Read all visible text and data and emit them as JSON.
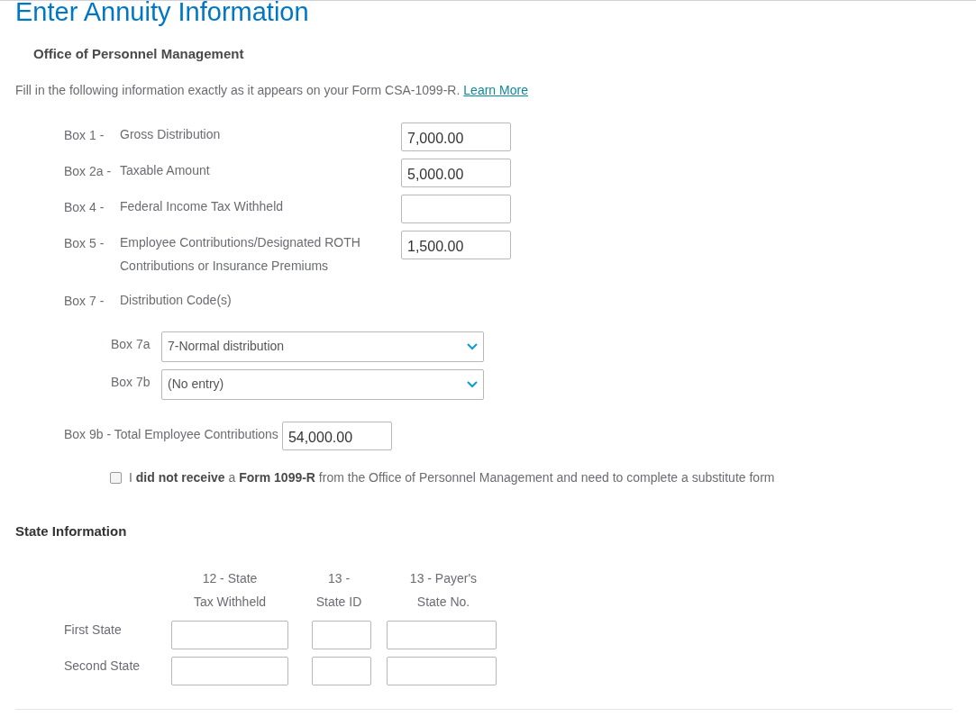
{
  "page": {
    "title": "Enter Annuity Information"
  },
  "section": {
    "heading": "Office of Personnel Management",
    "intro": "Fill in the following information exactly as it appears on your Form CSA-1099-R.",
    "link": "Learn More"
  },
  "boxes": [
    {
      "kind": "input",
      "box": "Box 1 -",
      "label": "Gross Distribution",
      "value": "7,000.00"
    },
    {
      "kind": "input",
      "box": "Box 2a -",
      "label": "Taxable Amount",
      "value": "5,000.00"
    },
    {
      "kind": "input",
      "box": "Box 4 -",
      "label": "Federal Income Tax Withheld"
    },
    {
      "kind": "input",
      "box": "Box 5 -",
      "label": "Employee Contributions/Designated ROTH Contributions or Insurance Premiums",
      "value": "1,500.00"
    },
    {
      "kind": "heading",
      "box": "Box 7 -",
      "label": "Distribution Code(s)"
    }
  ],
  "distribution_codes": [
    {
      "label": "Box 7a",
      "value": "7-Normal distribution"
    },
    {
      "label": "Box 7b",
      "value": "(No entry)"
    }
  ],
  "box_9b": {
    "label": "Box 9b - Total Employee Contributions",
    "value": "54,000.00"
  },
  "substitute_form": {
    "checked": false,
    "text": "I **did not receive** a **Form 1099-R** from the Office of Personnel Management and need to complete a substitute form"
  },
  "state_information": {
    "heading": "State Information",
    "columns": [
      {
        "line1": "12 - State",
        "line2": "Tax Withheld"
      },
      {
        "line1": "13 -",
        "line2": "State ID"
      },
      {
        "line1": "13 - Payer's",
        "line2": "State No."
      }
    ],
    "rows": [
      {
        "label": "First State"
      },
      {
        "label": "Second State"
      }
    ]
  }
}
